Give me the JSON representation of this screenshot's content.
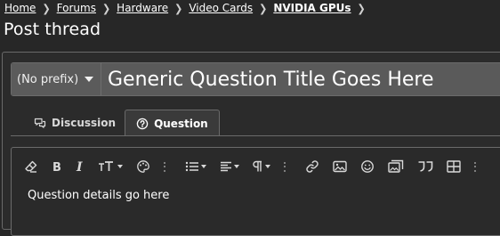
{
  "breadcrumb": {
    "items": [
      "Home",
      "Forums",
      "Hardware",
      "Video Cards",
      "NVIDIA GPUs"
    ]
  },
  "page": {
    "title": "Post thread"
  },
  "form": {
    "prefix": "(No prefix)",
    "title_value": "Generic Question Title Goes Here"
  },
  "tabs": [
    {
      "label": "Discussion",
      "icon": "speech-bubbles-icon"
    },
    {
      "label": "Question",
      "icon": "question-circle-icon",
      "active": true
    }
  ],
  "editor": {
    "toolbar_icons": [
      "eraser-icon",
      "bold-icon",
      "italic-icon",
      "text-size-icon",
      "palette-icon",
      "more-icon",
      "list-icon",
      "align-icon",
      "paragraph-icon",
      "more-icon",
      "link-icon",
      "image-icon",
      "smiley-icon",
      "media-icon",
      "quote-icon",
      "table-icon",
      "more-icon"
    ],
    "content": "Question details go here"
  },
  "colors": {
    "background": "#272727",
    "input_bg": "#5a5a5a",
    "border": "#6b6b6b",
    "text": "#ffffff"
  }
}
